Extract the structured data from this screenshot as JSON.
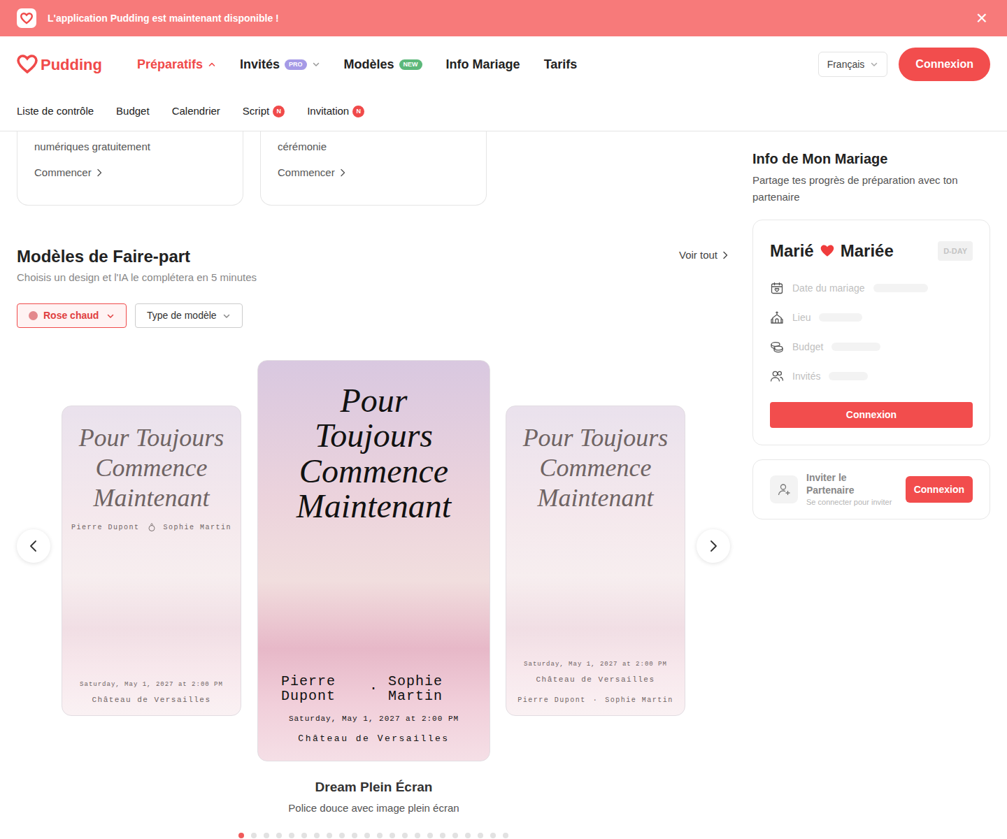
{
  "banner": {
    "text": "L'application Pudding est maintenant disponible !",
    "close": "×"
  },
  "navbar": {
    "logo": "Pudding",
    "items": [
      {
        "label": "Préparatifs",
        "selected": true,
        "expanded": true
      },
      {
        "label": "Invités",
        "selected": false,
        "expanded": false,
        "badge": "PRO",
        "badge_color": "#a59ae6"
      },
      {
        "label": "Modèles",
        "selected": false,
        "badge": "NEW",
        "badge_color": "#5cb87a"
      },
      {
        "label": "Info Mariage",
        "selected": false
      },
      {
        "label": "Tarifs",
        "selected": false
      }
    ],
    "language": "Français",
    "login": "Connexion"
  },
  "subnav": [
    {
      "label": "Liste de contrôle"
    },
    {
      "label": "Budget"
    },
    {
      "label": "Calendrier"
    },
    {
      "label": "Script",
      "badge": "N"
    },
    {
      "label": "Invitation",
      "badge": "N"
    }
  ],
  "feature_cards": [
    {
      "text": "numériques gratuitement",
      "action": "Commencer"
    },
    {
      "text": "cérémonie",
      "action": "Commencer"
    }
  ],
  "templates": {
    "title": "Modèles de Faire-part",
    "subtitle": "Choisis un design et l'IA le complétera en 5 minutes",
    "see_all": "Voir tout",
    "filters": [
      {
        "label": "Rose chaud",
        "selected": true,
        "color": "#e3888c"
      },
      {
        "label": "Type de modèle",
        "selected": false
      }
    ],
    "slides": [
      {
        "kind": "names-top",
        "selected": false,
        "title": "Pour Toujours Commence Maintenant",
        "names": [
          "Pierre Dupont",
          "Sophie Martin"
        ],
        "date": "Saturday, May 1, 2027 at 2:00 PM",
        "venue": "Château de Versailles"
      },
      {
        "kind": "featured",
        "selected": true,
        "title": "Pour Toujours Commence Maintenant",
        "names": [
          "Pierre Dupont",
          "Sophie Martin"
        ],
        "separator": "·",
        "date": "Saturday, May 1, 2027 at 2:00 PM",
        "venue": "Château de Versailles"
      },
      {
        "kind": "names-last",
        "selected": false,
        "title": "Pour Toujours Commence Maintenant",
        "names": [
          "Pierre Dupont",
          "Sophie Martin"
        ],
        "separator": "·",
        "date": "Saturday, May 1, 2027 at 2:00 PM",
        "venue": "Château de Versailles"
      }
    ],
    "caption": {
      "title": "Dream Plein Écran",
      "subtitle": "Police douce avec image plein écran"
    },
    "dots": [
      {
        "selected": true
      },
      {
        "selected": false
      },
      {
        "selected": false
      },
      {
        "selected": false
      },
      {
        "selected": false
      },
      {
        "selected": false
      },
      {
        "selected": false
      },
      {
        "selected": false
      },
      {
        "selected": false
      },
      {
        "selected": false
      },
      {
        "selected": false
      },
      {
        "selected": false
      },
      {
        "selected": false
      },
      {
        "selected": false
      },
      {
        "selected": false
      },
      {
        "selected": false
      },
      {
        "selected": false
      },
      {
        "selected": false
      },
      {
        "selected": false
      },
      {
        "selected": false
      },
      {
        "selected": false
      },
      {
        "selected": false
      }
    ]
  },
  "sidebar": {
    "title": "Info de Mon Mariage",
    "subtitle": "Partage tes progrès de préparation avec ton partenaire",
    "card": {
      "groom": "Marié",
      "bride": "Mariée",
      "badge": "D-DAY",
      "fields": [
        {
          "label": "Date du mariage"
        },
        {
          "label": "Lieu"
        },
        {
          "label": "Budget"
        },
        {
          "label": "Invités"
        }
      ],
      "button": "Connexion"
    },
    "invite": {
      "title": "Inviter le Partenaire",
      "subtitle": "Se connecter pour inviter",
      "button": "Connexion"
    }
  }
}
